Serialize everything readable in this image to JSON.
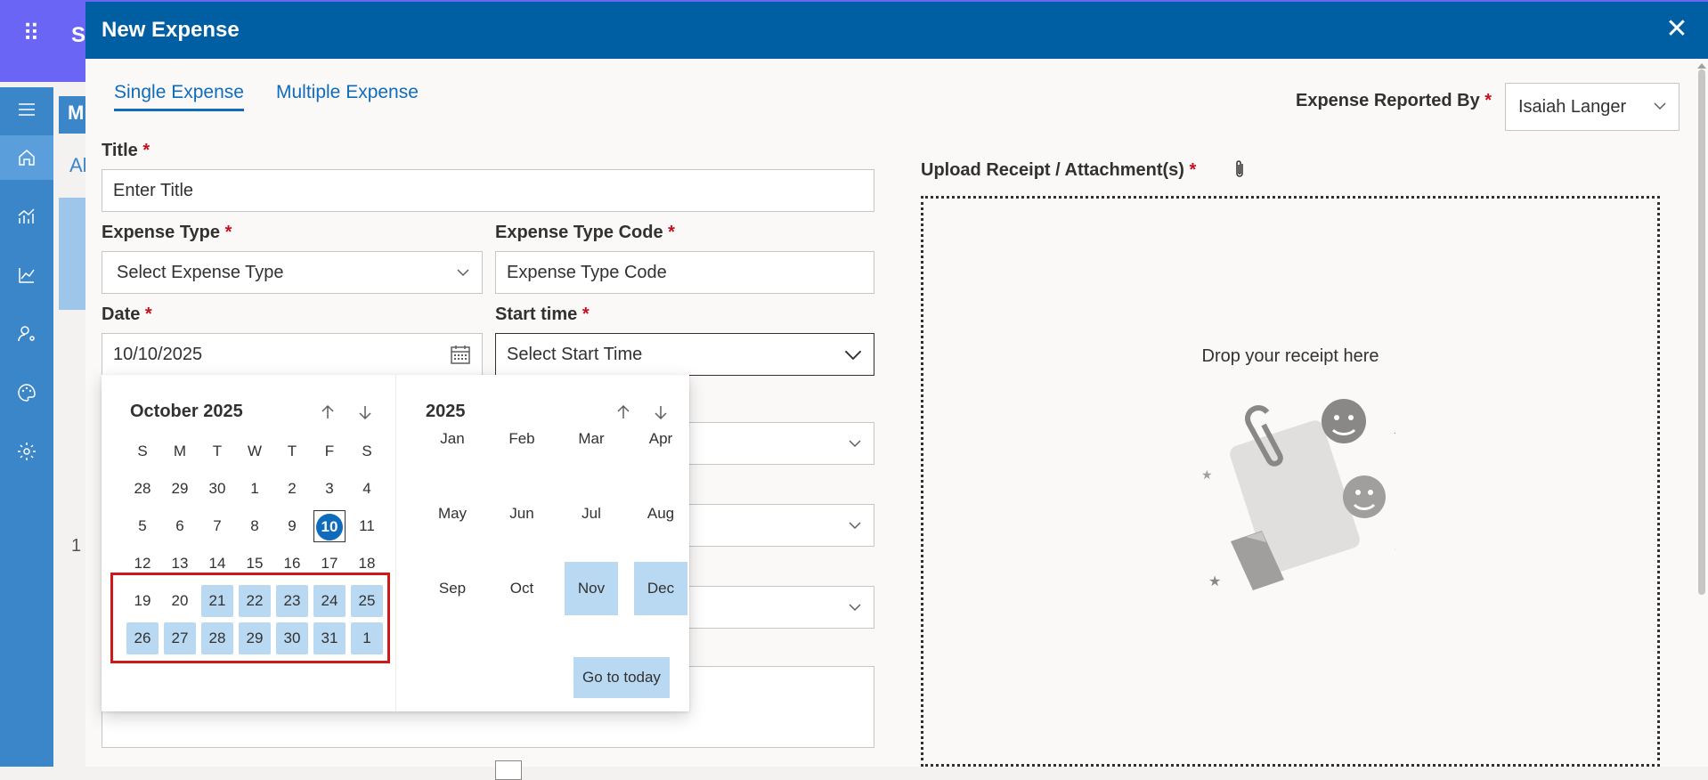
{
  "background_app": {
    "app_letter": "S",
    "panel_letter": "M",
    "tab_letter": "Al",
    "page_number": "1"
  },
  "modal": {
    "title": "New Expense",
    "tabs": [
      {
        "label": "Single Expense",
        "active": true
      },
      {
        "label": "Multiple Expense",
        "active": false
      }
    ],
    "reported_by": {
      "label": "Expense Reported By",
      "value": "Isaiah Langer"
    },
    "fields": {
      "title": {
        "label": "Title",
        "placeholder": "Enter Title"
      },
      "expense_type": {
        "label": "Expense Type",
        "placeholder": "Select Expense Type"
      },
      "expense_type_code": {
        "label": "Expense Type Code",
        "placeholder": "Expense Type Code"
      },
      "date": {
        "label": "Date",
        "value": "10/10/2025"
      },
      "start_time": {
        "label": "Start time",
        "placeholder": "Select Start Time"
      }
    },
    "required_marker": "*",
    "upload": {
      "label": "Upload Receipt / Attachment(s)",
      "drop_text": "Drop your receipt here"
    }
  },
  "calendar": {
    "month_title": "October 2025",
    "day_headers": [
      "S",
      "M",
      "T",
      "W",
      "T",
      "F",
      "S"
    ],
    "weeks": [
      [
        "28",
        "29",
        "30",
        "1",
        "2",
        "3",
        "4"
      ],
      [
        "5",
        "6",
        "7",
        "8",
        "9",
        "10",
        "11"
      ],
      [
        "12",
        "13",
        "14",
        "15",
        "16",
        "17",
        "18"
      ],
      [
        "19",
        "20",
        "21",
        "22",
        "23",
        "24",
        "25"
      ],
      [
        "26",
        "27",
        "28",
        "29",
        "30",
        "31",
        "1"
      ]
    ],
    "today": "10",
    "highlighted_days": [
      "21",
      "22",
      "23",
      "24",
      "25",
      "26",
      "27",
      "28",
      "29",
      "30",
      "31",
      "1"
    ],
    "year_title": "2025",
    "months": [
      "Jan",
      "Feb",
      "Mar",
      "Apr",
      "May",
      "Jun",
      "Jul",
      "Aug",
      "Sep",
      "Oct",
      "Nov",
      "Dec"
    ],
    "highlighted_months": [
      "Nov",
      "Dec"
    ],
    "go_to_today": "Go to today"
  },
  "colors": {
    "header_blue": "#005ea2",
    "accent": "#0f6cbd",
    "highlight": "#b9d9f3",
    "selection_box": "#d01818",
    "required": "#c50f1f"
  }
}
